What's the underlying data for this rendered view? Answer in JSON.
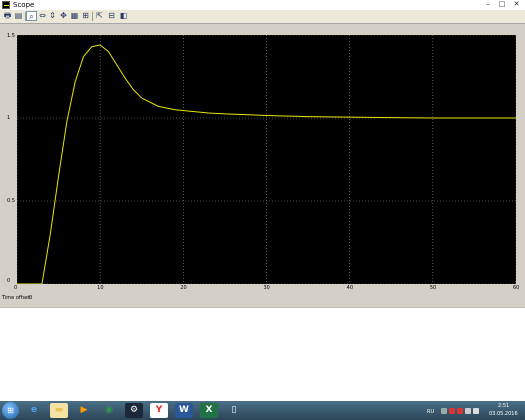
{
  "window": {
    "title": "Scope",
    "minimize": "–",
    "maximize": "□",
    "close": "✕"
  },
  "toolbar": {
    "buttons": [
      {
        "name": "print-icon",
        "glyph": "🖶"
      },
      {
        "name": "parameters-icon",
        "glyph": "▤"
      },
      {
        "name": "zoom-icon",
        "glyph": "⌕"
      },
      {
        "name": "zoom-x-icon",
        "glyph": "⇔"
      },
      {
        "name": "zoom-y-icon",
        "glyph": "⇕"
      },
      {
        "name": "autoscale-icon",
        "glyph": "✥"
      },
      {
        "name": "save-axes-icon",
        "glyph": "▦"
      },
      {
        "name": "restore-axes-icon",
        "glyph": "⊞"
      },
      {
        "name": "floating-scope-icon",
        "glyph": "⇱"
      },
      {
        "name": "lock-axes-icon",
        "glyph": "⊟"
      },
      {
        "name": "signal-selection-icon",
        "glyph": "◧"
      }
    ]
  },
  "time_offset": {
    "label": "Time offset:",
    "value": "0"
  },
  "chart_data": {
    "type": "line",
    "x": [
      0,
      2,
      3,
      4,
      5,
      6,
      7,
      8,
      9,
      10,
      11,
      12,
      13,
      14,
      15,
      17,
      19,
      21,
      23,
      25,
      30,
      35,
      40,
      45,
      50,
      55,
      60
    ],
    "series": [
      {
        "values": [
          0,
          0,
          0,
          0.3,
          0.65,
          0.98,
          1.22,
          1.37,
          1.43,
          1.44,
          1.4,
          1.32,
          1.24,
          1.17,
          1.12,
          1.07,
          1.05,
          1.04,
          1.03,
          1.025,
          1.015,
          1.008,
          1.005,
          1.002,
          1.0,
          1.0,
          1.0
        ]
      }
    ],
    "xlim": [
      0,
      60
    ],
    "ylim": [
      0,
      1.5
    ],
    "x_ticks": [
      "0",
      "10",
      "20",
      "30",
      "40",
      "50",
      "60"
    ],
    "y_ticks": [
      "0",
      "0.5",
      "1",
      "1.5"
    ],
    "grid": true,
    "line_color": "#e6e600",
    "background": "#000000",
    "grid_color": "#8c8c8c"
  },
  "taskbar": {
    "apps": [
      {
        "name": "ie-icon",
        "glyph": "e",
        "color": "#4aa3e8",
        "bg": "transparent"
      },
      {
        "name": "explorer-icon",
        "glyph": "▬",
        "color": "#e9c45a",
        "bg": "#f3e2a4"
      },
      {
        "name": "media-player-icon",
        "glyph": "▶",
        "color": "#ff9d00",
        "bg": "transparent"
      },
      {
        "name": "chrome-icon",
        "glyph": "◉",
        "color": "#2e9e44",
        "bg": "transparent"
      },
      {
        "name": "steam-icon",
        "glyph": "⚙",
        "color": "#ffffff",
        "bg": "#1b2838"
      },
      {
        "name": "yandex-icon",
        "glyph": "Y",
        "color": "#e52620",
        "bg": "#ffffff"
      },
      {
        "name": "word-icon",
        "glyph": "W",
        "color": "#ffffff",
        "bg": "#2b579a"
      },
      {
        "name": "excel-icon",
        "glyph": "X",
        "color": "#ffffff",
        "bg": "#217346"
      },
      {
        "name": "document-icon",
        "glyph": "▯",
        "color": "#ffffff",
        "bg": "transparent"
      }
    ],
    "language": "RU",
    "time": "2:51",
    "date": "03.05.2016"
  }
}
